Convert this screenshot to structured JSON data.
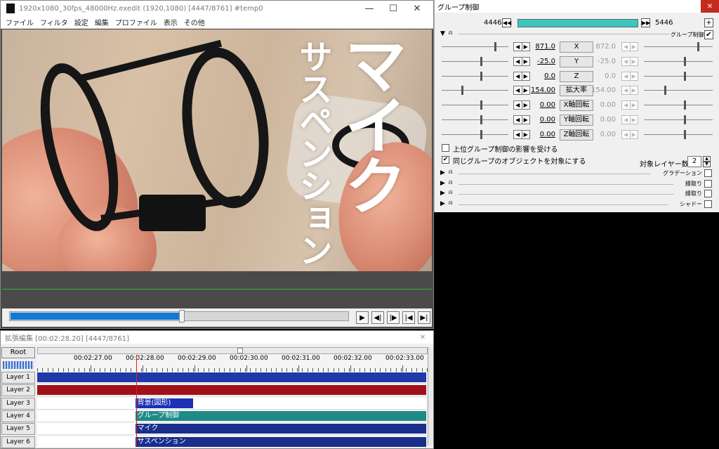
{
  "main_window": {
    "title": "1920x1080_30fps_48000Hz.exedit (1920,1080)  [4447/8761]  #temp0",
    "menu": [
      "ファイル",
      "フィルタ",
      "設定",
      "編集",
      "プロファイル",
      "表示",
      "その他"
    ],
    "preview_text": {
      "big": "マイク",
      "small": "サスペンション"
    },
    "seek_progress": 0.508
  },
  "group_control": {
    "title": "グループ制御",
    "frame_start": "4446",
    "frame_end": "5446",
    "header_label": "グループ制御",
    "header_checked": true,
    "params": [
      {
        "name": "X",
        "start": "871.0",
        "end": "872.0",
        "pos_start": 0.82,
        "pos_end": 0.8
      },
      {
        "name": "Y",
        "start": "-25.0",
        "end": "-25.0",
        "pos_start": 0.6,
        "pos_end": 0.6
      },
      {
        "name": "Z",
        "start": "0.0",
        "end": "0.0",
        "pos_start": 0.6,
        "pos_end": 0.6
      },
      {
        "name": "拡大率",
        "start": "154.00",
        "end": "154.00",
        "pos_start": 0.3,
        "pos_end": 0.3
      },
      {
        "name": "X軸回転",
        "start": "0.00",
        "end": "0.00",
        "pos_start": 0.6,
        "pos_end": 0.6
      },
      {
        "name": "Y軸回転",
        "start": "0.00",
        "end": "0.00",
        "pos_start": 0.6,
        "pos_end": 0.6
      },
      {
        "name": "Z軸回転",
        "start": "0.00",
        "end": "0.00",
        "pos_start": 0.6,
        "pos_end": 0.6
      }
    ],
    "checkbox_upper": {
      "label": "上位グループ制御の影響を受ける",
      "checked": false
    },
    "checkbox_same": {
      "label": "同じグループのオブジェクトを対象にする",
      "checked": true
    },
    "target_layers": {
      "label": "対象レイヤー数",
      "value": "2"
    },
    "filters": [
      "グラデーション",
      "縁取り",
      "縁取り",
      "シャドー"
    ]
  },
  "timeline": {
    "title": "拡張編集 [00:02:28.20] [4447/8761]",
    "root_label": "Root",
    "ruler_labels": [
      "00:02:27.00",
      "00:02:28.00",
      "00:02:29.00",
      "00:02:30.00",
      "00:02:31.00",
      "00:02:32.00",
      "00:02:33.00"
    ],
    "layers": [
      {
        "label": "Layer 1",
        "clip": "",
        "color": "#1f3aa8",
        "start": 0.0,
        "end": 1.0
      },
      {
        "label": "Layer 2",
        "clip": "",
        "color": "#a2101a",
        "start": 0.0,
        "end": 1.0
      },
      {
        "label": "Layer 3",
        "clip": "背景(図形)",
        "color": "#1b30b5",
        "start": 0.252,
        "end": 0.4
      },
      {
        "label": "Layer 4",
        "clip": "グループ制御",
        "color": "#1f8a87",
        "start": 0.252,
        "end": 1.0
      },
      {
        "label": "Layer 5",
        "clip": "マイク",
        "color": "#1a2e8c",
        "start": 0.252,
        "end": 1.0
      },
      {
        "label": "Layer 6",
        "clip": "サスペンション",
        "color": "#1a2e8c",
        "start": 0.252,
        "end": 1.0
      }
    ]
  }
}
